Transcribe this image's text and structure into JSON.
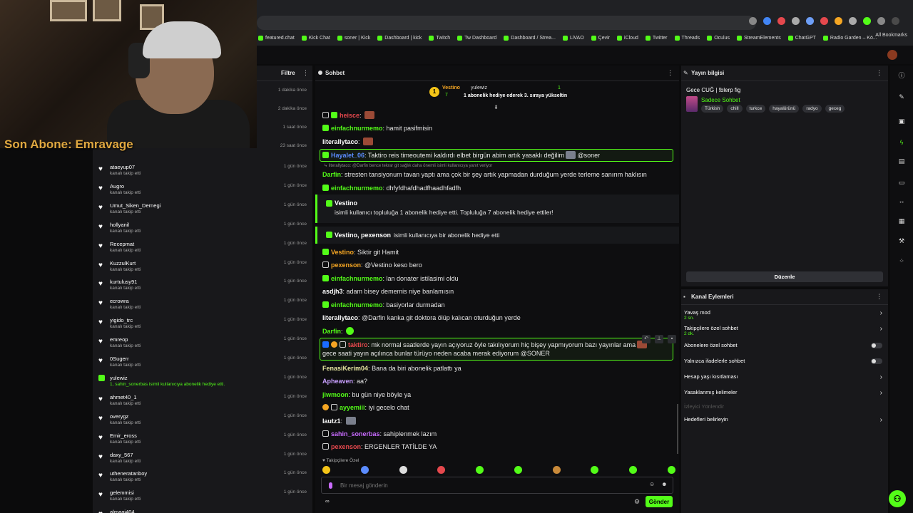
{
  "bookmarks": [
    "featured.chat",
    "Kick Chat",
    "soner | Kick",
    "Dashboard | kick",
    "Twitch",
    "Tw Dashboard",
    "Dashboard / Strea...",
    "LiVAO",
    "Çevir",
    "iCloud",
    "Twitter",
    "Threads",
    "Oculus",
    "StreamElements",
    "ChatGPT",
    "Radio Garden – Kö..."
  ],
  "all_bookmarks": "All Bookmarks",
  "overlay": {
    "last_sub": "Son Abone: Emravage"
  },
  "activity": {
    "filter_label": "Filtre",
    "top_times": [
      "1 dakika önce",
      "2 dakika önce",
      "1 saat önce",
      "23 saat önce"
    ],
    "items": [
      {
        "user": "ataeyup07",
        "detail": "kanalı takip etti",
        "time": "1 gün önce",
        "type": "follow"
      },
      {
        "user": "Augro",
        "detail": "kanalı takip etti",
        "time": "1 gün önce",
        "type": "follow"
      },
      {
        "user": "Umut_Siken_Dernegi",
        "detail": "kanalı takip etti",
        "time": "1 gün önce",
        "type": "follow"
      },
      {
        "user": "hollyanil",
        "detail": "kanalı takip etti",
        "time": "1 gün önce",
        "type": "follow"
      },
      {
        "user": "Recepmat",
        "detail": "kanalı takip etti",
        "time": "1 gün önce",
        "type": "follow"
      },
      {
        "user": "KuzzulKurt",
        "detail": "kanalı takip etti",
        "time": "1 gün önce",
        "type": "follow"
      },
      {
        "user": "kurtulusy91",
        "detail": "kanalı takip etti",
        "time": "1 gün önce",
        "type": "follow"
      },
      {
        "user": "ecrowra",
        "detail": "kanalı takip etti",
        "time": "1 gün önce",
        "type": "follow"
      },
      {
        "user": "yigido_trc",
        "detail": "kanalı takip etti",
        "time": "1 gün önce",
        "type": "follow"
      },
      {
        "user": "emreop",
        "detail": "kanalı takip etti",
        "time": "1 gün önce",
        "type": "follow"
      },
      {
        "user": "0Sugerr",
        "detail": "kanalı takip etti",
        "time": "1 gün önce",
        "type": "follow"
      },
      {
        "user": "yulewiz",
        "detail": "1, sahin_sonerbas isimli kullanıcıya abonelik hediye etti.",
        "time": "1 gün önce",
        "type": "gift"
      },
      {
        "user": "ahmet40_1",
        "detail": "kanalı takip etti",
        "time": "1 gün önce",
        "type": "follow"
      },
      {
        "user": "overygz",
        "detail": "kanalı takip etti",
        "time": "1 gün önce",
        "type": "follow"
      },
      {
        "user": "Emir_eross",
        "detail": "kanalı takip etti",
        "time": "1 gün önce",
        "type": "follow"
      },
      {
        "user": "daxy_567",
        "detail": "kanalı takip etti",
        "time": "1 gün önce",
        "type": "follow"
      },
      {
        "user": "utheneratanboy",
        "detail": "kanalı takip etti",
        "time": "1 gün önce",
        "type": "follow"
      },
      {
        "user": "gelemmisi",
        "detail": "kanalı takip etti",
        "time": "1 gün önce",
        "type": "follow"
      },
      {
        "user": "almaai404",
        "detail": "",
        "time": "",
        "type": "follow"
      }
    ]
  },
  "chat": {
    "title": "Sohbet",
    "pinned": {
      "name": "Vestino",
      "count": "7",
      "user": "yulewiz",
      "num": "1",
      "message": "1 abonelik hediye ederek 3. sıraya yükseltin"
    },
    "messages": [
      {
        "user": "heisce",
        "text": "",
        "color": "#e5484d"
      },
      {
        "user": "einfachnurmemo",
        "text": "hamit pasifmisin",
        "color": "#53fc18"
      },
      {
        "user": "literallytaco",
        "text": "",
        "color": "#ffffff"
      },
      {
        "user": "Hayalet_06",
        "text": "Taktiro reis timeoutemi kaldırdı elbet birgün abim artık yasaklı değilim",
        "mention": "@soner",
        "color": "#5b8cff"
      },
      {
        "reply": "↳ literallytaco: @Darfin bence tekrar git sağlık daha önemli isimli kullanıcıya yanıt veriyor"
      },
      {
        "user": "Darfin",
        "text": "stresten tansiyonum tavan yaptı ama çok bir şey artık yapmadan durduğum yerde terleme sanırım haklısın",
        "color": "#53fc18"
      },
      {
        "user": "einfachnurmemo",
        "text": "dhfyfdhafdhadfhaadhfadfh",
        "color": "#53fc18"
      },
      {
        "user": "Vestino",
        "text": "Siktir git Hamit",
        "color": "#f5a623"
      },
      {
        "user": "pexenson",
        "text": "@Vestino keso bero",
        "color": "#f5a623"
      },
      {
        "user": "einfachnurmemo",
        "text": "lan donater istilasimi oldu",
        "color": "#53fc18"
      },
      {
        "user": "asdjh3",
        "text": "adam bisey dememis niye banlamısın",
        "color": "#ffffff"
      },
      {
        "user": "einfachnurmemo",
        "text": "basiyorlar durmadan",
        "color": "#53fc18"
      },
      {
        "user": "literallytaco",
        "text": "@Darfin kanka git doktora ölüp kalıcan oturduğun yerde",
        "color": "#ffffff"
      },
      {
        "user": "Darfin",
        "text": "",
        "color": "#53fc18"
      },
      {
        "user": "taktiro",
        "text": "mk normal saatlerde yayın açıyoruz öyle takılıyorum hiç bişey yapmıyorum bazı yayınlar ama",
        "text2": "gece saati yayın açılınca bunlar türüyo neden acaba merak ediyorum",
        "mention": "@SONER",
        "color": "#e5484d"
      },
      {
        "user": "FenasiKerim04",
        "text": "Bana da biri abonelik patlattı ya",
        "color": "#e6e6a0"
      },
      {
        "user": "Apheaven",
        "text": "aa?",
        "color": "#c9a0ff"
      },
      {
        "user": "jiwmoon",
        "text": "bu gün niye böyle ya",
        "color": "#53fc18"
      },
      {
        "user": "ayyemiii",
        "text": "iyi gecelo chat",
        "color": "#53fc18"
      },
      {
        "user": "lautz1",
        "text": "",
        "color": "#ffffff"
      },
      {
        "user": "sahin_sonerbas",
        "text": "sahiplenmek lazım",
        "color": "#c96bff"
      },
      {
        "user": "pexenson",
        "text": "ERGENLER TATİLDE YA",
        "color": "#e5484d"
      }
    ],
    "sub_block_1": {
      "title": "Vestino",
      "text": "isimli kullanıcı topluluğa 1 abonelik hediye etti. Topluluğa 7 abonelik hediye ettiler!"
    },
    "sub_block_2": {
      "names": "Vestino, pexenson",
      "text": "isimli kullanıcıya bir abonelik hediye etti"
    },
    "followers_only": "♥ Takipçilere Özel",
    "input_placeholder": "Bir mesaj gönderin",
    "points": "∞",
    "send_label": "Gönder"
  },
  "stream_info": {
    "title_label": "Yayın bilgisi",
    "stream_title": "Gece CUĞ | !blerp fig",
    "category": "Sadece Sohbet",
    "tags": [
      "Türkish",
      "chill",
      "turkce",
      "hayalürünü",
      "radyo",
      "geceg"
    ],
    "edit_label": "Düzenle"
  },
  "channel_actions": {
    "title": "Kanal Eylemleri",
    "rows": [
      {
        "label": "Yavaş mod",
        "sub": "2 sn.",
        "kind": "chevron"
      },
      {
        "label": "Takipçilere özel sohbet",
        "sub": "2 dk.",
        "kind": "chevron"
      },
      {
        "label": "Abonelere özel sohbet",
        "sub": "",
        "kind": "toggle"
      },
      {
        "label": "Yalnızca ifadelerle sohbet",
        "sub": "",
        "kind": "toggle"
      },
      {
        "label": "Hesap yaşı kısıtlaması",
        "sub": "",
        "kind": "chevron"
      },
      {
        "label": "Yasaklanmış kelimeler",
        "sub": "",
        "kind": "chevron"
      },
      {
        "label": "İzleyici Yönlendir",
        "sub": "",
        "kind": "disabled"
      },
      {
        "label": "Hedefleri belirleyin",
        "sub": "",
        "kind": "chevron"
      }
    ]
  }
}
